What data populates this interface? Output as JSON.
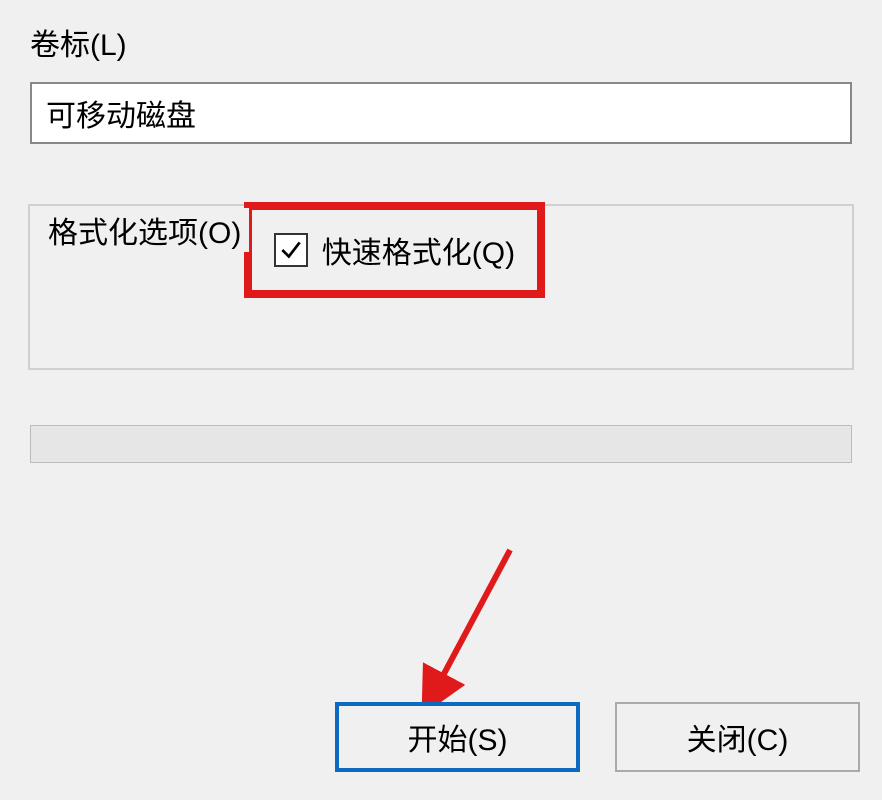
{
  "volume_label": {
    "label": "卷标(L)",
    "value": "可移动磁盘"
  },
  "format_options": {
    "legend": "格式化选项(O)",
    "quick_format_label": "快速格式化(Q)",
    "quick_format_checked": true
  },
  "buttons": {
    "start": "开始(S)",
    "close": "关闭(C)"
  },
  "annotation": {
    "highlight_color": "#e01a1a",
    "arrow_color": "#e01a1a"
  }
}
